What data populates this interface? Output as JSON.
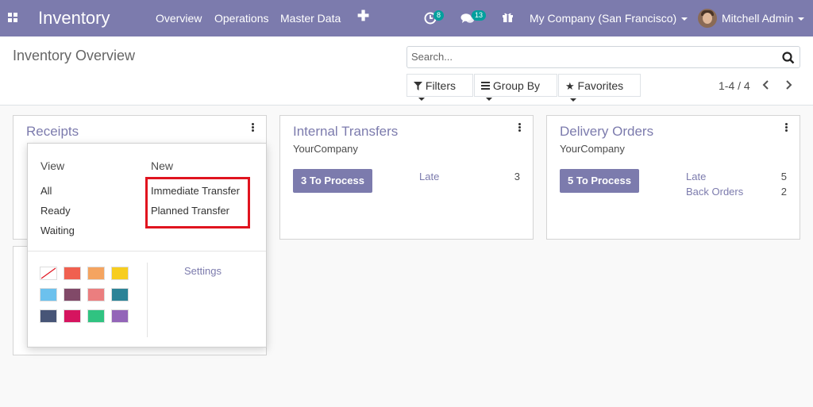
{
  "navbar": {
    "app_title": "Inventory",
    "menu": [
      "Overview",
      "Operations",
      "Master Data"
    ],
    "plus_icon": "plus-icon",
    "activity_count": "8",
    "messages_count": "13",
    "company": "My Company (San Francisco)",
    "user": "Mitchell Admin",
    "bg_color": "#7c7bad",
    "badge_color": "#00a09d"
  },
  "control_panel": {
    "title": "Inventory Overview",
    "search_placeholder": "Search...",
    "filters_label": "Filters",
    "groupby_label": "Group By",
    "favorites_label": "Favorites",
    "pager": "1-4 / 4"
  },
  "cards": [
    {
      "title": "Receipts"
    },
    {
      "title": "Internal Transfers",
      "company": "YourCompany",
      "process_label": "3 To Process",
      "stats": [
        {
          "label": "Late",
          "value": "3"
        }
      ]
    },
    {
      "title": "Delivery Orders",
      "company": "YourCompany",
      "process_label": "5 To Process",
      "stats": [
        {
          "label": "Late",
          "value": "5"
        },
        {
          "label": "Back Orders",
          "value": "2"
        }
      ]
    }
  ],
  "dropdown": {
    "view_header": "View",
    "new_header": "New",
    "view_items": [
      "All",
      "Ready",
      "Waiting"
    ],
    "new_items": [
      "Immediate Transfer",
      "Planned Transfer"
    ],
    "settings_label": "Settings",
    "highlight_color": "#e0141f",
    "colors": [
      "none",
      "#f06050",
      "#f4a460",
      "#f7cd1f",
      "#6cc1ed",
      "#814968",
      "#eb7e7f",
      "#2c8397",
      "#475577",
      "#d6145f",
      "#30c381",
      "#9365b8"
    ]
  }
}
